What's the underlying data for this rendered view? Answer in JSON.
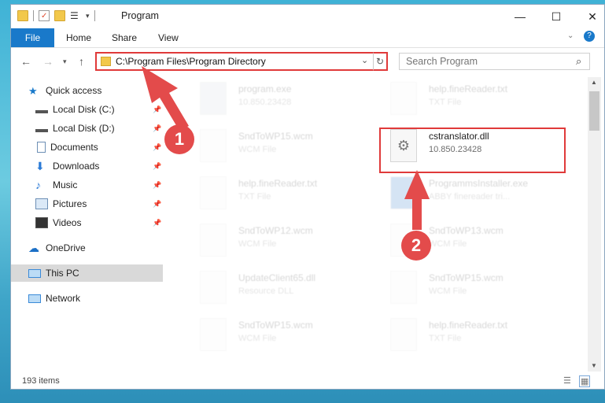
{
  "window": {
    "title": "Program"
  },
  "ribbon": {
    "file": "File",
    "tabs": [
      "Home",
      "Share",
      "View"
    ]
  },
  "address": {
    "path": "C:\\Program Files\\Program Directory"
  },
  "search": {
    "placeholder": "Search Program"
  },
  "sidebar": {
    "quick_access": "Quick access",
    "items": [
      {
        "label": "Local Disk (C:)",
        "icon": "drive-icon",
        "pinned": true
      },
      {
        "label": "Local Disk (D:)",
        "icon": "drive-icon",
        "pinned": true
      },
      {
        "label": "Documents",
        "icon": "documents-icon",
        "pinned": true
      },
      {
        "label": "Downloads",
        "icon": "download-icon",
        "pinned": true
      },
      {
        "label": "Music",
        "icon": "music-icon",
        "pinned": true
      },
      {
        "label": "Pictures",
        "icon": "pictures-icon",
        "pinned": true
      },
      {
        "label": "Videos",
        "icon": "videos-icon",
        "pinned": true
      }
    ],
    "onedrive": "OneDrive",
    "thispc": "This PC",
    "network": "Network"
  },
  "files": [
    {
      "name": "program.exe",
      "sub": "10.850.23428",
      "icon": "exe-icon"
    },
    {
      "name": "help.fineReader.txt",
      "sub": "TXT File",
      "icon": "doc-icon"
    },
    {
      "name": "SndToWP15.wcm",
      "sub": "WCM File",
      "icon": "doc-icon"
    },
    {
      "name": "cstranslator.dll",
      "sub": "10.850.23428",
      "icon": "gear-doc-icon"
    },
    {
      "name": "help.fineReader.txt",
      "sub": "TXT File",
      "icon": "doc-icon"
    },
    {
      "name": "ProgrammsInstaller.exe",
      "sub": "ABBY finereader tri...",
      "icon": "installer-icon"
    },
    {
      "name": "SndToWP12.wcm",
      "sub": "WCM File",
      "icon": "doc-icon"
    },
    {
      "name": "SndToWP13.wcm",
      "sub": "WCM File",
      "icon": "doc-icon"
    },
    {
      "name": "UpdateClient65.dll",
      "sub": "Resource DLL",
      "icon": "gear-doc-icon"
    },
    {
      "name": "SndToWP15.wcm",
      "sub": "WCM File",
      "icon": "doc-icon"
    },
    {
      "name": "SndToWP15.wcm",
      "sub": "WCM File",
      "icon": "doc-icon"
    },
    {
      "name": "help.fineReader.txt",
      "sub": "TXT File",
      "icon": "doc-icon"
    }
  ],
  "status": {
    "count": "193 items"
  },
  "callouts": {
    "one": "1",
    "two": "2"
  },
  "colors": {
    "accent": "#1979ca",
    "highlight": "#e03a3a"
  }
}
